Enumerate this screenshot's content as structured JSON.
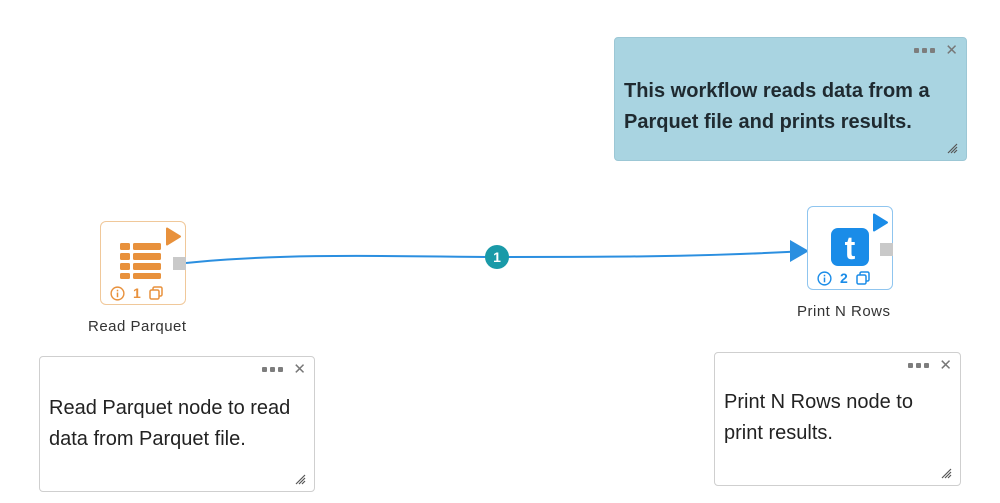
{
  "notes": {
    "top": {
      "text_line1": "This workflow reads data from a",
      "text_line2": "Parquet file and prints results."
    },
    "left": {
      "text_line1": "Read Parquet node to read",
      "text_line2": "data from Parquet file."
    },
    "right": {
      "text_line1": "Print N Rows node to",
      "text_line2": "print results."
    }
  },
  "nodes": {
    "read": {
      "label": "Read Parquet",
      "number": "1",
      "color": "#e8913c",
      "icon": "table-icon"
    },
    "print": {
      "label": "Print N Rows",
      "number": "2",
      "color": "#1a8ce8",
      "icon": "t-letter-icon"
    }
  },
  "edge": {
    "badge": "1",
    "badge_color": "#1a9aa8",
    "line_color": "#2b8fe0"
  }
}
